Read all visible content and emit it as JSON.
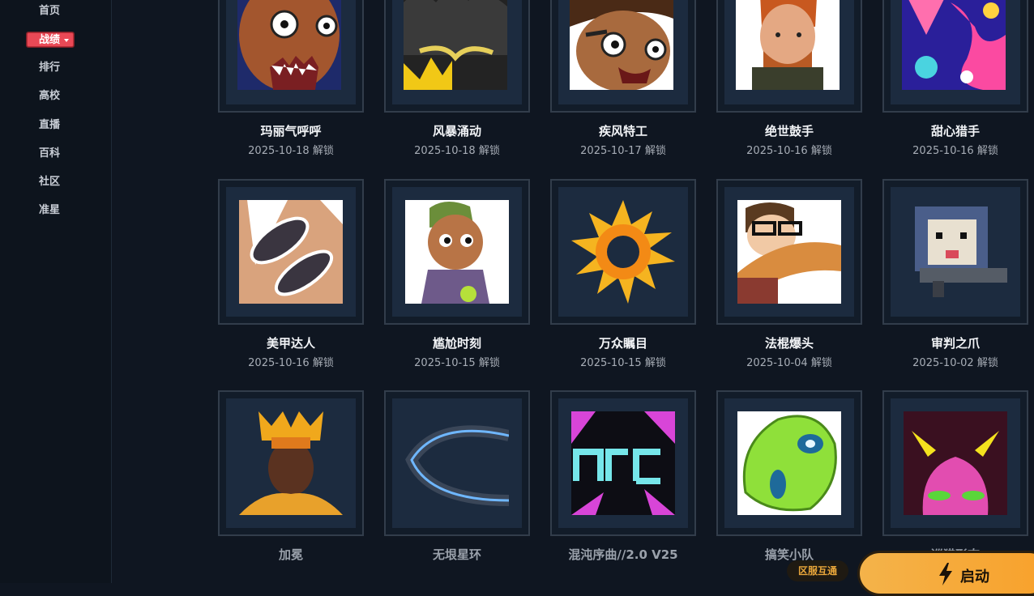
{
  "sidebar": {
    "items": [
      {
        "label": "首页"
      },
      {
        "label": "战绩"
      },
      {
        "label": "排行"
      },
      {
        "label": "高校"
      },
      {
        "label": "直播"
      },
      {
        "label": "百科"
      },
      {
        "label": "社区"
      },
      {
        "label": "准星"
      }
    ]
  },
  "cards": [
    {
      "name": "玛丽气呼呼",
      "date": "2025-10-18 解锁"
    },
    {
      "name": "风暴涌动",
      "date": "2025-10-18 解锁"
    },
    {
      "name": "疾风特工",
      "date": "2025-10-17 解锁"
    },
    {
      "name": "绝世鼓手",
      "date": "2025-10-16 解锁"
    },
    {
      "name": "甜心猎手",
      "date": "2025-10-16 解锁"
    },
    {
      "name": "美甲达人",
      "date": "2025-10-16 解锁"
    },
    {
      "name": "尴尬时刻",
      "date": "2025-10-15 解锁"
    },
    {
      "name": "万众瞩目",
      "date": "2025-10-15 解锁"
    },
    {
      "name": "法棍爆头",
      "date": "2025-10-04 解锁"
    },
    {
      "name": "审判之爪",
      "date": "2025-10-02 解锁"
    },
    {
      "name": "加冕",
      "date": ""
    },
    {
      "name": "无垠星环",
      "date": ""
    },
    {
      "name": "混沌序曲//2.0 V25",
      "date": ""
    },
    {
      "name": "搞笑小队",
      "date": ""
    },
    {
      "name": "巡猎形态",
      "date": ""
    }
  ],
  "footer": {
    "region_badge": "区服互通",
    "launch_label": "启动"
  }
}
